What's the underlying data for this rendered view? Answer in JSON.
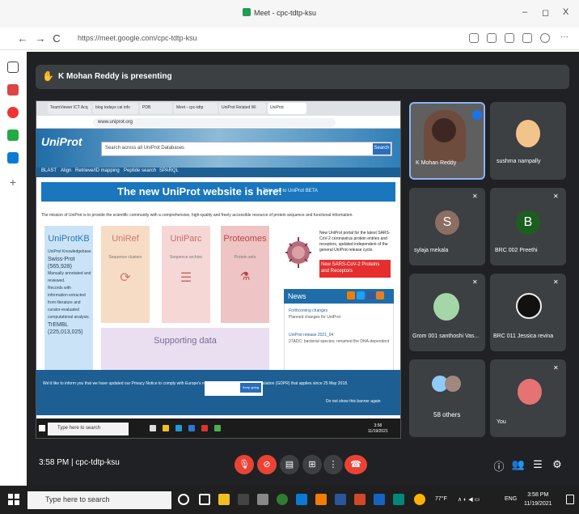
{
  "window": {
    "title": "Meet - cpc-tdtp-ksu",
    "minimize": "–",
    "maximize": "◻",
    "close": "X"
  },
  "browser": {
    "url": "https://meet.google.com/cpc-tdtp-ksu",
    "back": "←",
    "forward": "→",
    "reload": "C"
  },
  "meet": {
    "presenter_text": "K Mohan Reddy is presenting",
    "time": "3:58 PM",
    "meeting_code": "cpc-tdtp-ksu",
    "participants": [
      {
        "name": "K Mohan Reddy"
      },
      {
        "name": "sushma nampally"
      },
      {
        "name": "sylaja mekala",
        "initial": "S",
        "color": "#8d6e63"
      },
      {
        "name": "BRC 002 Preethi",
        "initial": "B",
        "color": "#1b5e20"
      },
      {
        "name": "Grom 001 santhoshi Vas..."
      },
      {
        "name": "BRC 011 Jessica revina"
      },
      {
        "name": "58 others"
      },
      {
        "name": "You"
      }
    ]
  },
  "shared": {
    "tab_labels": [
      "TeamViewer ICT Acq",
      "blog todays cal info",
      "PDB",
      "Meet - cpc-tdtp",
      "UniProt Related Wi",
      "UniProt"
    ],
    "url": "www.uniprot.org",
    "logo": "UniProt",
    "search_text": "Search across all UniProt Databases",
    "search_btn": "Search",
    "nav": [
      "BLAST",
      "Align",
      "Retrieve/ID mapping",
      "Peptide search",
      "SPARQL"
    ],
    "banner": "The new UniProt website is here!",
    "banner_link": "Take me to UniProt BETA",
    "mission": "The mission of UniProt is to provide the scientific community with a comprehensive, high-quality and freely accessible resource of protein sequence and functional information.",
    "cards": {
      "uniprotkb": "UniProtKB",
      "uniprotkb_items": [
        "UniProt Knowledgebase",
        "Swiss-Prot (565,928)",
        "Manually annotated and reviewed.",
        "Records with information extracted from literature and curator-evaluated computational analysis.",
        "TrEMBL (225,013,025)"
      ],
      "uniref": "UniRef",
      "uniref_sub": "Sequence clusters",
      "uniparc": "UniParc",
      "uniparc_sub": "Sequence archive",
      "proteomes": "Proteomes",
      "proteomes_sub": "Protein sets",
      "supporting": "Supporting data"
    },
    "covid_text": "New UniProt portal for the latest SARS-CoV-2 coronavirus protein entries and receptors, updated independent of the general UniProt release cycle.",
    "covid_link": "New SARS-CoV-2 Proteins and Receptors",
    "news_title": "News",
    "news": [
      "Forthcoming changes",
      "Planned changes for UniProt",
      "UniProt release 2021_04",
      "27ADC: bacterial species; renamed the DNA-dependent"
    ],
    "cookie_text": "We'd like to inform you that we have updated our Privacy Notice to comply with Europe's new General Data Protection Regulation (GDPR) that applies since 25 May 2018.",
    "cookie_btn": "Keep going",
    "close_text": "Do not show this banner again",
    "taskbar_search": "Type here to search",
    "taskbar_time": "3:58",
    "taskbar_date": "11/19/2021"
  },
  "taskbar": {
    "search_placeholder": "Type here to search",
    "weather": "77°F",
    "lang": "ENG",
    "time": "3:58 PM",
    "date": "11/19/2021"
  }
}
